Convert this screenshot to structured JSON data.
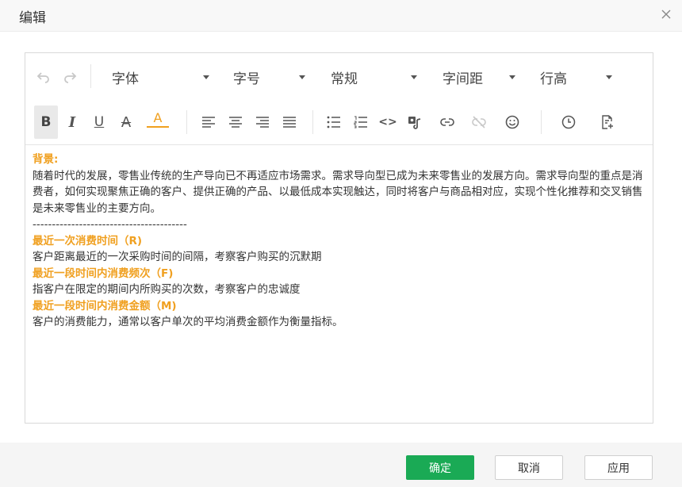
{
  "dialog": {
    "title": "编辑"
  },
  "toolbar": {
    "dropdowns": {
      "font_family": "字体",
      "font_size": "字号",
      "text_style": "常规",
      "letter_spacing": "字间距",
      "line_height": "行高"
    },
    "bold_label": "B",
    "italic_label": "I",
    "underline_label": "U",
    "strike_label": "A",
    "font_color_label": "A",
    "font_color_accent": "#f0a020",
    "code_label": "<>"
  },
  "content": {
    "heading_bg": "背景:",
    "para_bg": "随着时代的发展，零售业传统的生产导向已不再适应市场需求。需求导向型已成为未来零售业的发展方向。需求导向型的重点是消费者，如何实现聚焦正确的客户、提供正确的产品、以最低成本实现触达，同时将客户与商品相对应，实现个性化推荐和交叉销售是未来零售业的主要方向。",
    "divider_line": "----------------------------------------",
    "heading_r": "最近一次消费时间（R)",
    "para_r": "客户距离最近的一次采购时间的间隔，考察客户购买的沉默期",
    "heading_f": "最近一段时间内消费频次（F)",
    "para_f": "指客户在限定的期间内所购买的次数，考察客户的忠诚度",
    "heading_m": "最近一段时间内消费金额（M)",
    "para_m": "客户的消费能力，通常以客户单次的平均消费金额作为衡量指标。"
  },
  "footer": {
    "confirm_label": "确定",
    "cancel_label": "取消",
    "apply_label": "应用"
  },
  "colors": {
    "primary": "#1aaa55",
    "highlight": "#f0a020"
  }
}
